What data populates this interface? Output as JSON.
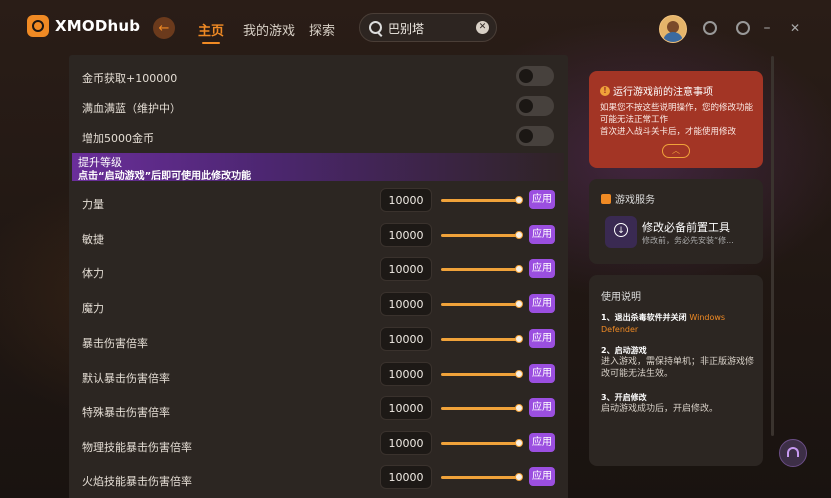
{
  "app": {
    "logo_text": "XMODhub"
  },
  "nav": {
    "items": [
      "主页",
      "我的游戏",
      "探索"
    ],
    "active": "主页"
  },
  "search": {
    "value": "巴别塔",
    "placeholder": ""
  },
  "toggles": [
    {
      "label": "金币获取+100000",
      "on": false
    },
    {
      "label": "满血满蓝（维护中）",
      "on": false
    },
    {
      "label": "增加5000金币",
      "on": false
    }
  ],
  "level_banner": {
    "title": "提升等级",
    "subtitle": "点击“启动游戏”后即可使用此修改功能"
  },
  "apply_label": "应用",
  "stats": [
    {
      "label": "力量",
      "value": "10000"
    },
    {
      "label": "敏捷",
      "value": "10000"
    },
    {
      "label": "体力",
      "value": "10000"
    },
    {
      "label": "魔力",
      "value": "10000"
    },
    {
      "label": "暴击伤害倍率",
      "value": "10000"
    },
    {
      "label": "默认暴击伤害倍率",
      "value": "10000"
    },
    {
      "label": "特殊暴击伤害倍率",
      "value": "10000"
    },
    {
      "label": "物理技能暴击伤害倍率",
      "value": "10000"
    },
    {
      "label": "火焰技能暴击伤害倍率",
      "value": "10000"
    }
  ],
  "notice": {
    "title": "运行游戏前的注意事项",
    "lines": [
      "如果您不按这些说明操作，您的修改功能",
      "可能无法正常工作",
      "首次进入战斗关卡后，才能使用修改"
    ]
  },
  "service": {
    "title": "游戏服务",
    "tool_title": "修改必备前置工具",
    "tool_desc": "修改前，务必先安装“修..."
  },
  "guide": {
    "title": "使用说明",
    "step1_title": "1、退出杀毒软件并关闭",
    "step1_highlight": "Windows Defender",
    "step2_title": "2、启动游戏",
    "step2_desc": "进入游戏，需保持单机；非正版游戏修改可能无法生效。",
    "step3_title": "3、开启修改",
    "step3_desc": "启动游戏成功后，开启修改。"
  },
  "colors": {
    "accent": "#f08a24",
    "apply": "#9b4fe0",
    "notice_bg": "#a33525"
  }
}
